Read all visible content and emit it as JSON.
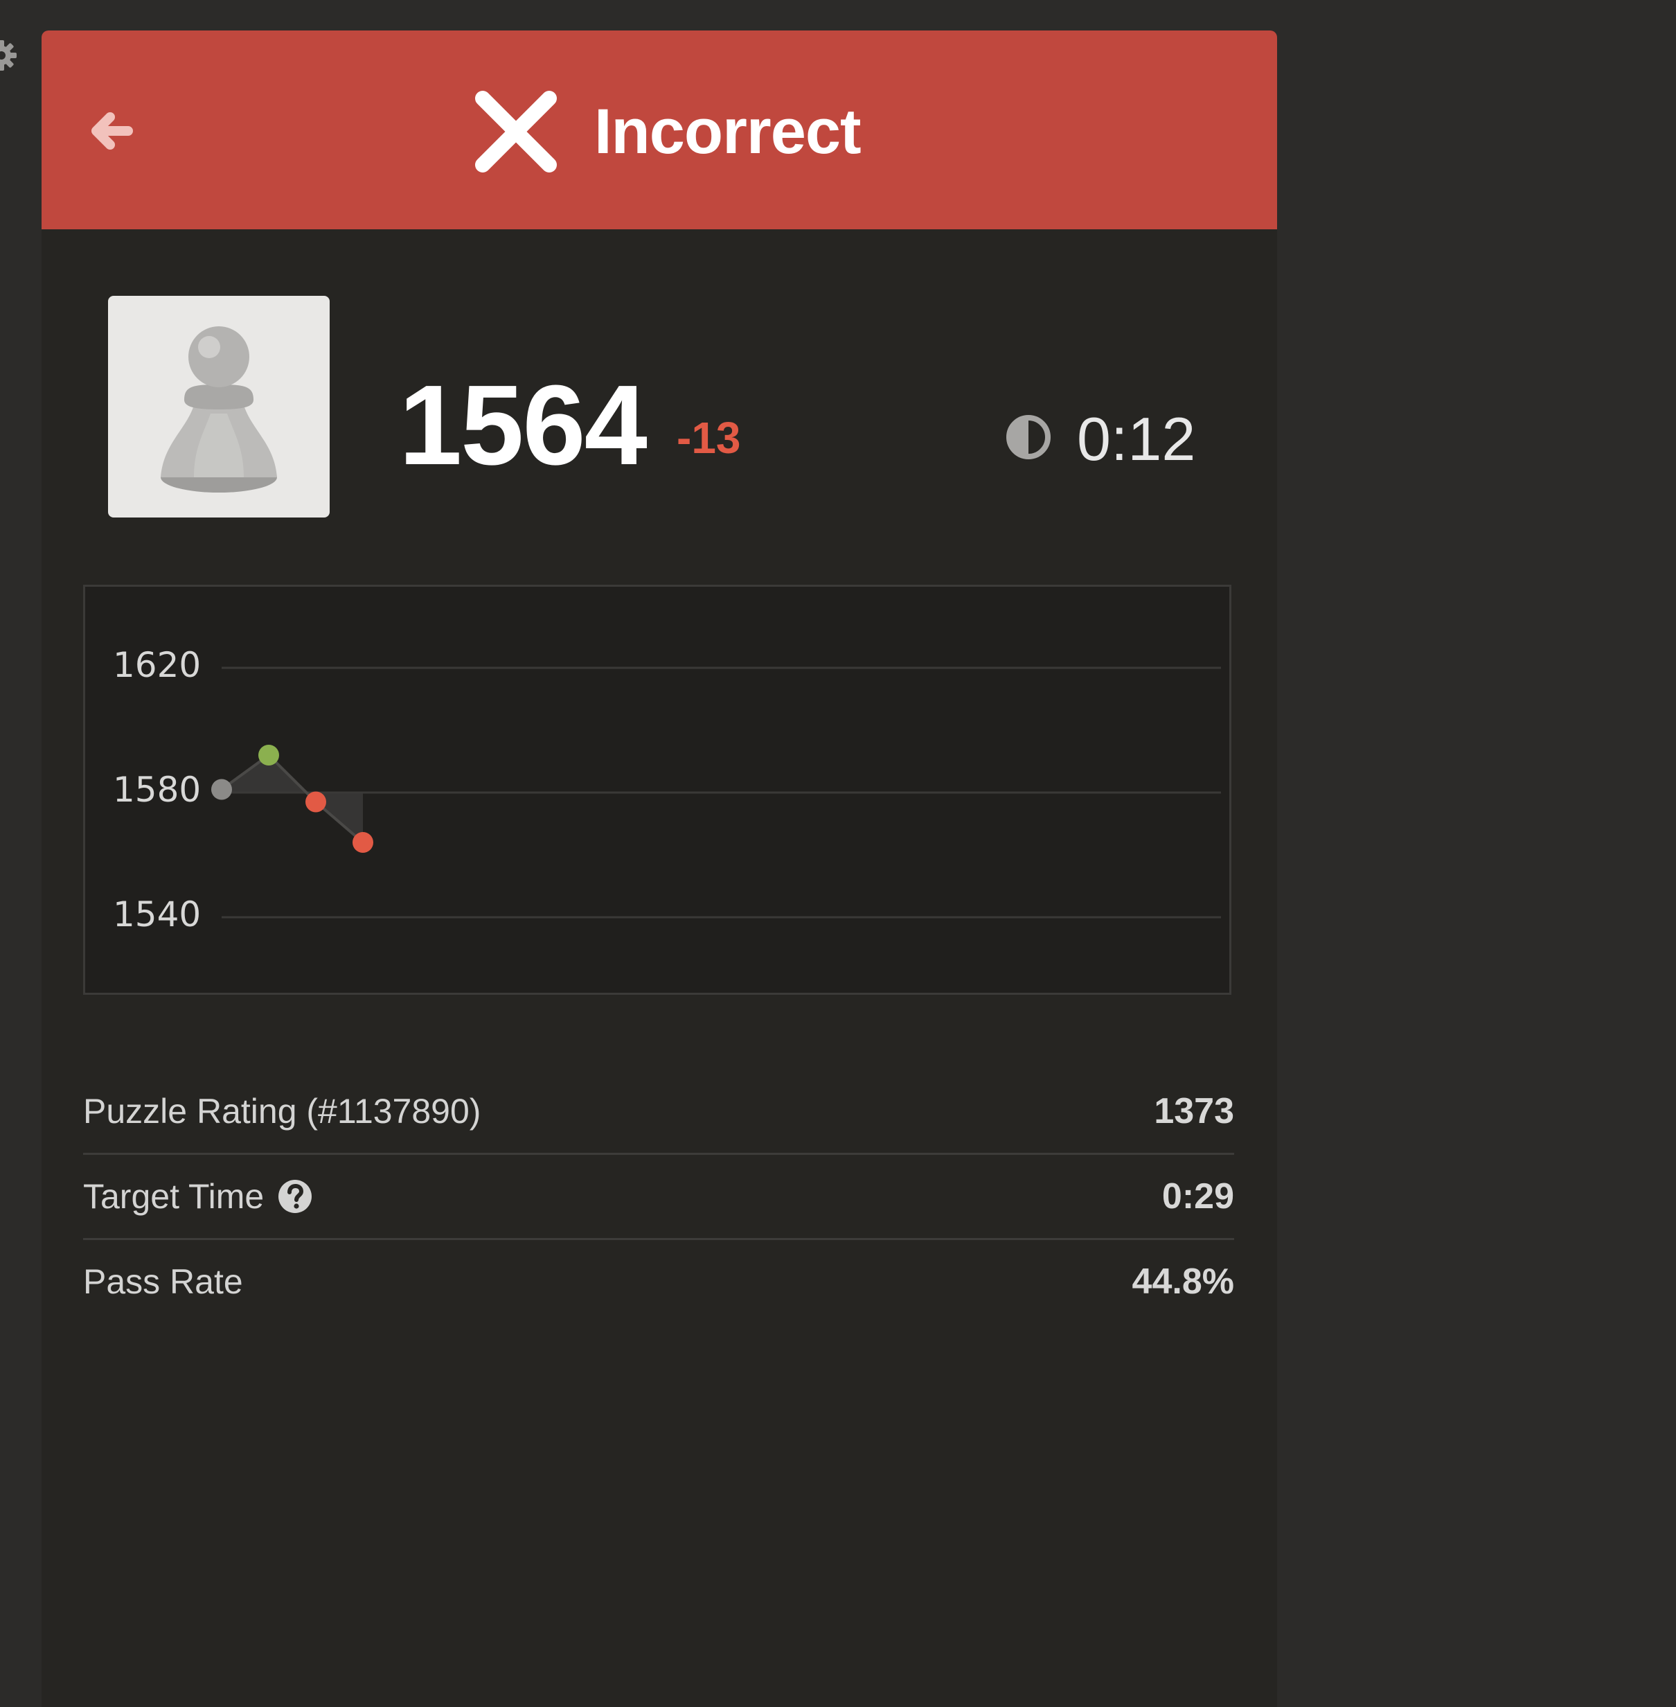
{
  "header": {
    "status": "Incorrect",
    "back_icon": "arrow-left-icon",
    "status_icon": "x-mark-icon",
    "background_color": "#c0483e"
  },
  "player": {
    "piece_icon": "pawn-icon",
    "rating": "1564",
    "rating_change": "-13",
    "time": "0:12",
    "time_icon": "clock-icon"
  },
  "chart_data": {
    "type": "line",
    "x": [
      1,
      2,
      3,
      4
    ],
    "values": [
      1581,
      1592,
      1577,
      1564
    ],
    "point_colors": [
      "#8b8a88",
      "#8bb04f",
      "#e25a45",
      "#e25a45"
    ],
    "baseline": 1580,
    "yticks": [
      "1620",
      "1580",
      "1540"
    ],
    "ylim": [
      1540,
      1620
    ],
    "grid": true
  },
  "stats": [
    {
      "label": "Puzzle Rating (#1137890)",
      "value": "1373"
    },
    {
      "label": "Target Time",
      "value": "0:29",
      "icon": "help-icon"
    },
    {
      "label": "Pass Rate",
      "value": "44.8%"
    }
  ],
  "colors": {
    "incorrect_red": "#c0483e",
    "negative": "#e25a45",
    "positive": "#8bb04f"
  }
}
